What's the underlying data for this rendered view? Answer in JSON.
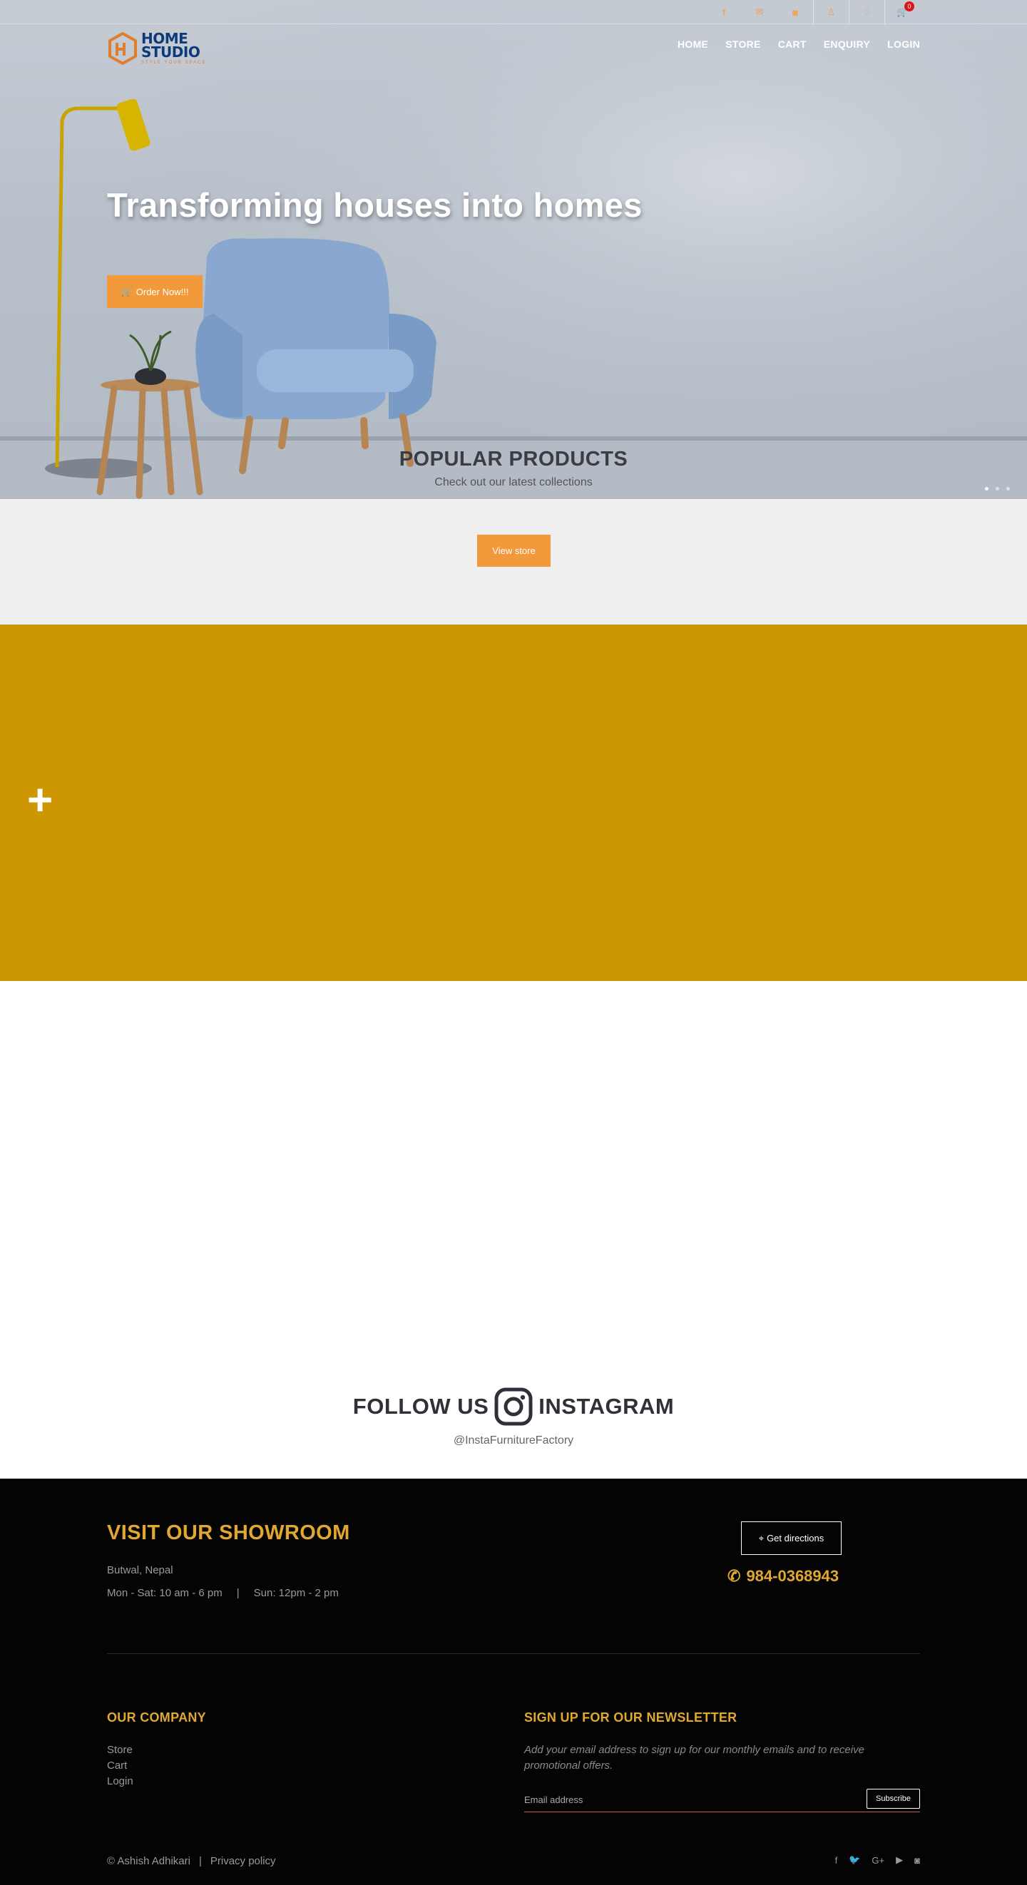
{
  "topbar": {
    "icons": [
      "facebook-icon",
      "mail-icon",
      "instagram-icon",
      "user-icon",
      "heart-icon",
      "cart-icon"
    ],
    "cart_count": "0"
  },
  "logo": {
    "title_line1": "HOME",
    "title_line2": "STUDIO",
    "tagline": "STYLE YOUR SPACE"
  },
  "nav": {
    "items": [
      "HOME",
      "STORE",
      "CART",
      "ENQUIRY",
      "LOGIN"
    ]
  },
  "hero": {
    "title": "Transforming houses into homes",
    "order_button": "Order Now!!!",
    "slides": 3,
    "active_slide": 1
  },
  "popular": {
    "title": "POPULAR PRODUCTS",
    "subtitle": "Check out our latest collections",
    "view_store_button": "View store"
  },
  "banner": {
    "plus_symbol": "+"
  },
  "instagram": {
    "follow_text": "FOLLOW US",
    "instagram_text": "INSTAGRAM",
    "handle": "@InstaFurnitureFactory"
  },
  "footer": {
    "visit_title": "VISIT OUR SHOWROOM",
    "address": "Butwal, Nepal",
    "hours_weekday": "Mon - Sat: 10 am - 6 pm",
    "hours_sep": "|",
    "hours_sunday": "Sun: 12pm - 2 pm",
    "directions_button": "Get directions",
    "phone": "984-0368943",
    "company_title": "OUR COMPANY",
    "company_links": [
      "Store",
      "Cart",
      "Login"
    ],
    "newsletter_title": "SIGN UP FOR OUR NEWSLETTER",
    "newsletter_desc": "Add your email address to sign up for our monthly emails and to receive promotional offers.",
    "email_placeholder": "Email address",
    "subscribe_button": "Subscribe",
    "copyright": "© Ashish Adhikari",
    "copyright_sep": "|",
    "privacy": "Privacy policy",
    "social_icons": [
      "facebook-icon",
      "twitter-icon",
      "google-plus-icon",
      "youtube-icon",
      "instagram-icon"
    ]
  },
  "colors": {
    "accent_orange": "#f29a3b",
    "accent_gold": "#e0a82f",
    "banner_yellow": "#cc9700",
    "footer_bg": "#040404",
    "logo_blue": "#0f3a7a",
    "badge_red": "#d9141b"
  }
}
